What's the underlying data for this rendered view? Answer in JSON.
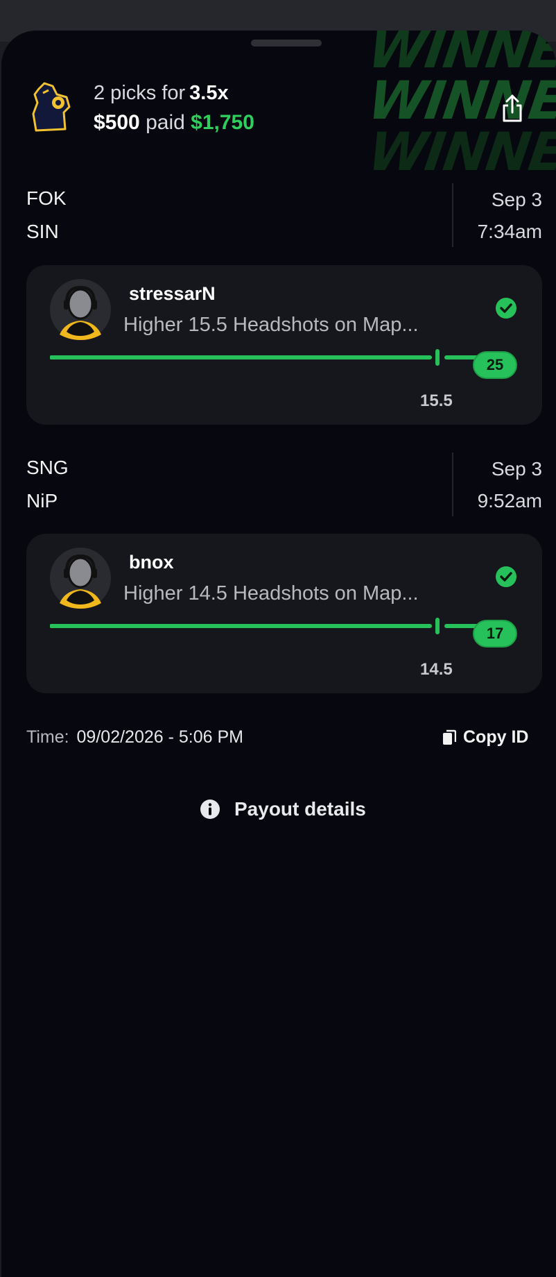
{
  "header": {
    "picks_text": "2 picks for",
    "multiplier": "3.5x",
    "stake": "$500",
    "paid_word": "paid",
    "payout": "$1,750",
    "winner_banner": [
      "WINNER!!",
      "WINNER!",
      "WINNER!"
    ]
  },
  "picks": [
    {
      "team1": "FOK",
      "team2": "SIN",
      "date": "Sep 3",
      "time": "7:34am",
      "player": "stressarN",
      "description": "Higher 15.5 Headshots on Map...",
      "line": "15.5",
      "result": "25",
      "status": "won"
    },
    {
      "team1": "SNG",
      "team2": "NiP",
      "date": "Sep 3",
      "time": "9:52am",
      "player": "bnox",
      "description": "Higher 14.5 Headshots on Map...",
      "line": "14.5",
      "result": "17",
      "status": "won"
    }
  ],
  "footer": {
    "time_label": "Time:",
    "time_value": "09/02/2026 - 5:06 PM",
    "copy_label": "Copy ID",
    "payout_details_label": "Payout details"
  },
  "colors": {
    "accent_green": "#2ecf5c",
    "background": "#07080f",
    "card": "#16171c"
  }
}
